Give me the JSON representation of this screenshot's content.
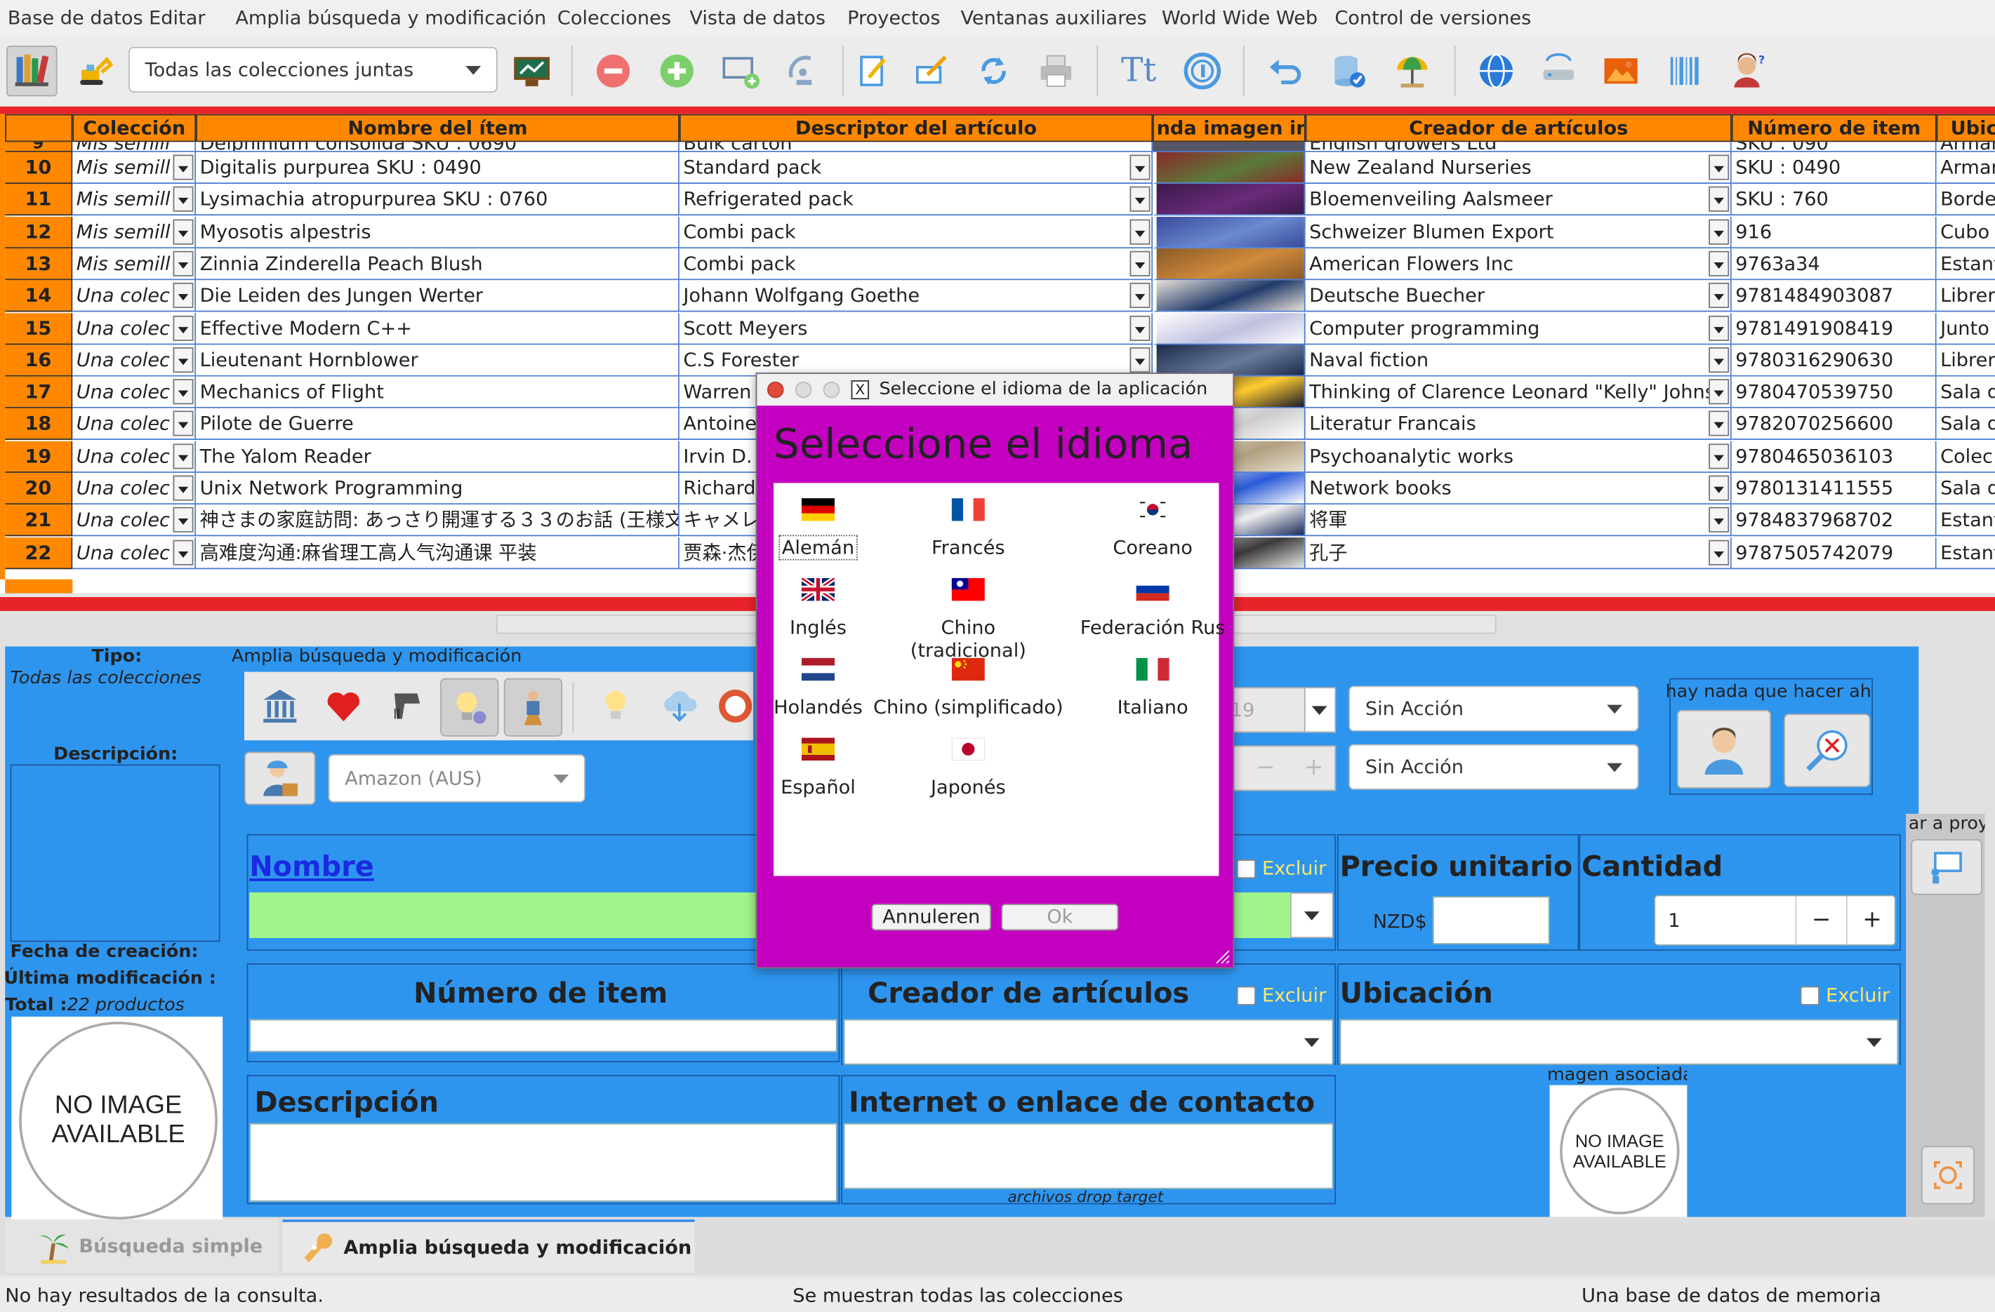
{
  "menubar": [
    "Base de datos",
    "Editar",
    "Amplia búsqueda y modificación",
    "Colecciones",
    "Vista de datos",
    "Proyectos",
    "Ventanas auxiliares",
    "World Wide Web",
    "Control de versiones"
  ],
  "toolbar": {
    "collection_select": "Todas las colecciones juntas"
  },
  "grid": {
    "headers": [
      "Colección",
      "Nombre del ítem",
      "Descriptor del artículo",
      "nda imagen im",
      "Creador de artículos",
      "Número de item",
      "Ubic"
    ],
    "partial_row": {
      "num": "9",
      "name": "Delphinium consolida SKU : 0690",
      "desc": "Bulk carton",
      "creator": "English growers Ltd",
      "number": "SKU : 090",
      "loc": "Armar"
    },
    "rows": [
      {
        "num": "10",
        "coll": "Mis semill",
        "name": "Digitalis purpurea SKU : 0490",
        "desc": "Standard pack",
        "creator": "New Zealand Nurseries",
        "number": "SKU : 0490",
        "loc": "Armar"
      },
      {
        "num": "11",
        "coll": "Mis semill",
        "name": "Lysimachia atropurpurea SKU : 0760",
        "desc": "Refrigerated pack",
        "creator": "Bloemenveiling Aalsmeer",
        "number": "SKU : 760",
        "loc": "Borde"
      },
      {
        "num": "12",
        "coll": "Mis semill",
        "name": "Myosotis alpestris",
        "desc": "Combi pack",
        "creator": "Schweizer Blumen Export",
        "number": "916",
        "loc": "Cubo"
      },
      {
        "num": "13",
        "coll": "Mis semill",
        "name": "Zinnia Zinderella Peach Blush",
        "desc": "Combi pack",
        "creator": "American Flowers Inc",
        "number": "9763a34",
        "loc": "Estant"
      },
      {
        "num": "14",
        "coll": "Una colec",
        "name": "Die Leiden des Jungen Werter",
        "desc": "Johann Wolfgang Goethe",
        "creator": "Deutsche Buecher",
        "number": "9781484903087",
        "loc": "Librer"
      },
      {
        "num": "15",
        "coll": "Una colec",
        "name": "Effective Modern C++",
        "desc": "Scott Meyers",
        "creator": "Computer programming",
        "number": "9781491908419",
        "loc": "Junto"
      },
      {
        "num": "16",
        "coll": "Una colec",
        "name": "Lieutenant Hornblower",
        "desc": "C.S Forester",
        "creator": "Naval fiction",
        "number": "9780316290630",
        "loc": "Librer"
      },
      {
        "num": "17",
        "coll": "Una colec",
        "name": "Mechanics of Flight",
        "desc": "Warren",
        "creator": "Thinking of Clarence Leonard \"Kelly\" Johnso",
        "number": "9780470539750",
        "loc": "Sala d"
      },
      {
        "num": "18",
        "coll": "Una colec",
        "name": "Pilote de Guerre",
        "desc": "Antoine",
        "creator": "Literatur Francais",
        "number": "9782070256600",
        "loc": "Sala d"
      },
      {
        "num": "19",
        "coll": "Una colec",
        "name": "The Yalom Reader",
        "desc": "Irvin D.",
        "creator": "Psychoanalytic works",
        "number": "9780465036103",
        "loc": "Colec"
      },
      {
        "num": "20",
        "coll": "Una colec",
        "name": "Unix Network Programming",
        "desc": "Richard",
        "creator": "Network books",
        "number": "9780131411555",
        "loc": "Sala d"
      },
      {
        "num": "21",
        "coll": "Una colec",
        "name": "神さまの家庭訪問: あっさり開運する３３のお話 (王様文庫)",
        "desc": "キャメレ",
        "creator": "将軍",
        "number": "9784837968702",
        "loc": "Estant"
      },
      {
        "num": "22",
        "coll": "Una colec",
        "name": "高难度沟通:麻省理工高人气沟通课 平装",
        "desc": "贾森·杰伊",
        "creator": "孔子",
        "number": "9787505742079",
        "loc": "Estant"
      }
    ]
  },
  "side": {
    "tipo_label": "Tipo:",
    "tipo_value": "Todas las colecciones",
    "desc_label": "Descripción:",
    "created_label": "Fecha de creación:",
    "modified_label": "Última modificación :",
    "total_label": "Total :",
    "total_value": "22 productos",
    "no_image": "NO IMAGE AVAILABLE"
  },
  "search": {
    "group_label": "Amplia búsqueda y modificación",
    "vendor_select": "Amazon (AUS)",
    "date_value": "19",
    "action_1": "Sin Acción",
    "action_2": "Sin Acción",
    "nothing_todo": "hay nada que hacer ah",
    "nombre_label": "Nombre",
    "exclude": "Excluir",
    "precio_label": "Precio unitario",
    "currency": "NZD$",
    "cantidad_label": "Cantidad",
    "cantidad_value": "1",
    "minus": "−",
    "plus": "+",
    "numero_label": "Número de item",
    "creador_label": "Creador de artículos",
    "ubicacion_label": "Ubicación",
    "descripcion_label": "Descripción",
    "internet_label": "Internet o enlace de contacto",
    "drop_target": "archivos drop target",
    "assoc_image": "magen asociada",
    "project_label": "ar a proy"
  },
  "tabs": {
    "simple": "Búsqueda simple",
    "advanced": "Amplia búsqueda y modificación"
  },
  "status": {
    "left": "No hay resultados de la consulta.",
    "center": "Se muestran todas las colecciones",
    "right": "Una base de datos de memoria"
  },
  "dialog": {
    "title": "Seleccione el idioma de la aplicación",
    "heading": "Seleccione el idioma",
    "languages": [
      "Alemán",
      "Francés",
      "Coreano",
      "Inglés",
      "Chino (tradicional)",
      "Federación Rus",
      "Holandés",
      "Chino (simplificado)",
      "Italiano",
      "Español",
      "Japonés"
    ],
    "cancel": "Annuleren",
    "ok": "Ok"
  }
}
